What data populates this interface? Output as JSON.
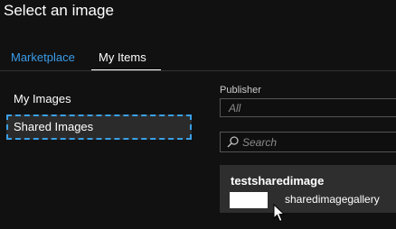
{
  "header": {
    "title": "Select an image"
  },
  "tabs": [
    {
      "label": "Marketplace",
      "selected": false
    },
    {
      "label": "My Items",
      "selected": true
    }
  ],
  "left_nav": {
    "items": [
      {
        "label": "My Images",
        "selected": false
      },
      {
        "label": "Shared Images",
        "selected": true
      }
    ]
  },
  "filters": {
    "publisher_label": "Publisher",
    "publisher_value": "All",
    "search_placeholder": "Search"
  },
  "results": [
    {
      "name": "testsharedimage",
      "gallery": "sharedimagegallery"
    }
  ],
  "colors": {
    "background": "#111111",
    "accent": "#3a9be8",
    "card": "#2e2e2e",
    "focus_outline": "#3aa0e8"
  },
  "icons": [
    "search-icon",
    "mouse-pointer-icon"
  ]
}
